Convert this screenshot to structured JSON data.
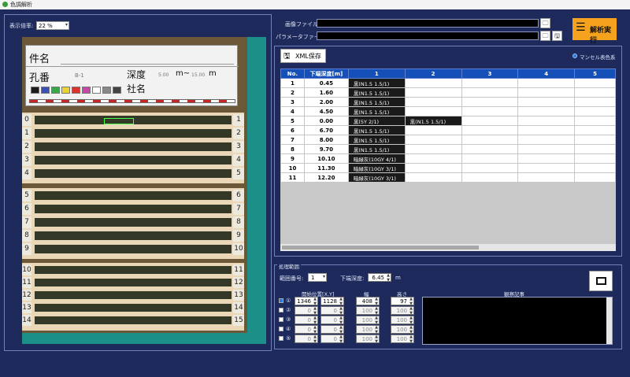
{
  "window": {
    "title": "色調解析"
  },
  "zoom": {
    "label": "表示倍率:",
    "value": "22 %"
  },
  "files": {
    "image_label": "画像ファイル:",
    "param_label": "パラメータファイル:",
    "run_button": "解析実行"
  },
  "grid": {
    "xml_save": "XML保存",
    "munsell_label": "マンセル表色系",
    "columns": [
      "No.",
      "下端深度[m]",
      "1",
      "2",
      "3",
      "4",
      "5"
    ],
    "rows": [
      {
        "no": "1",
        "depth": "0.45",
        "c1": "黒(N1.5 1.5/1)",
        "c2": ""
      },
      {
        "no": "2",
        "depth": "1.60",
        "c1": "黒(N1.5 1.5/1)",
        "c2": ""
      },
      {
        "no": "3",
        "depth": "2.00",
        "c1": "黒(N1.5 1.5/1)",
        "c2": ""
      },
      {
        "no": "4",
        "depth": "4.50",
        "c1": "黒(N1.5 1.5/1)",
        "c2": ""
      },
      {
        "no": "5",
        "depth": "0.00",
        "c1": "黒(5Y 2/1)",
        "c2": "黒(N1.5 1.5/1)"
      },
      {
        "no": "6",
        "depth": "6.70",
        "c1": "黒(N1.5 1.5/1)",
        "c2": ""
      },
      {
        "no": "7",
        "depth": "8.00",
        "c1": "黒(N1.5 1.5/1)",
        "c2": ""
      },
      {
        "no": "8",
        "depth": "9.70",
        "c1": "黒(N1.5 1.5/1)",
        "c2": ""
      },
      {
        "no": "9",
        "depth": "10.10",
        "c1": "暗緑灰(10GY 4/1)",
        "c2": ""
      },
      {
        "no": "10",
        "depth": "11.30",
        "c1": "暗緑灰(10GY 3/1)",
        "c2": ""
      },
      {
        "no": "11",
        "depth": "12.20",
        "c1": "暗緑灰(10GY 3/1)",
        "c2": ""
      }
    ]
  },
  "processing": {
    "title": "処理範囲",
    "range_no_label": "範囲番号:",
    "range_no": "1",
    "lower_depth_label": "下端深度:",
    "lower_depth": "6.45",
    "unit": "m",
    "col_start": "開始位置[X,Y]",
    "col_width": "幅",
    "col_height": "高さ",
    "col_notes": "観察記事",
    "regions": [
      {
        "num": "①",
        "x": "1346",
        "y": "1128",
        "w": "408",
        "h": "97",
        "enabled": true
      },
      {
        "num": "②",
        "x": "0",
        "y": "0",
        "w": "100",
        "h": "100",
        "enabled": false
      },
      {
        "num": "③",
        "x": "0",
        "y": "0",
        "w": "100",
        "h": "100",
        "enabled": false
      },
      {
        "num": "④",
        "x": "0",
        "y": "0",
        "w": "100",
        "h": "100",
        "enabled": false
      },
      {
        "num": "⑤",
        "x": "0",
        "y": "0",
        "w": "100",
        "h": "100",
        "enabled": false
      }
    ]
  },
  "photo": {
    "card": {
      "name_label": "件名",
      "hole_label": "孔番",
      "hole_value": "B-1",
      "depth_label": "深度",
      "depth_from": "5.00",
      "depth_to": "15.00",
      "depth_unit": "m~",
      "depth_unit2": "m",
      "company_label": "社名"
    },
    "swatches": [
      "#1b1b1b",
      "#3a4fb8",
      "#39a84a",
      "#e8d234",
      "#d9342e",
      "#c54aa8",
      "#ffffff",
      "#888888",
      "#444444"
    ],
    "box1_left": [
      "0",
      "1",
      "2",
      "3",
      "4"
    ],
    "box1_right": [
      "1",
      "2",
      "3",
      "4",
      "5"
    ],
    "box2_left": [
      "5",
      "6",
      "7",
      "8",
      "9"
    ],
    "box2_right": [
      "6",
      "7",
      "8",
      "9",
      "10"
    ],
    "box3_left": [
      "10",
      "11",
      "12",
      "13",
      "14"
    ],
    "box3_right": [
      "11",
      "12",
      "13",
      "14",
      "15"
    ]
  }
}
